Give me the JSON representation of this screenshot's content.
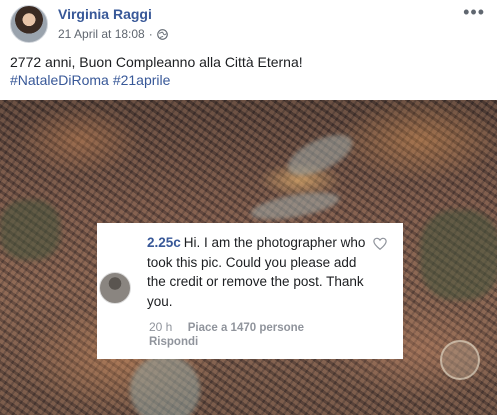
{
  "post": {
    "author": "Virginia Raggi",
    "timestamp": "21 April at 18:08",
    "separator": "·",
    "privacy_icon": "globe-icon",
    "more_icon": "more-options-icon",
    "more_label": "•••",
    "text": "2772 anni, Buon Compleanno alla Città Eterna!",
    "hashtags": [
      "#NataleDiRoma",
      "#21aprile"
    ]
  },
  "comment": {
    "username": "2.25c",
    "text": "Hi. I am the photographer who took this pic. Could you please add the credit or remove the post. Thank you.",
    "time": "20 h",
    "likes": "Piace a 1470 persone",
    "reply": "Rispondi",
    "like_icon": "heart-icon"
  },
  "colors": {
    "link": "#385898",
    "meta": "#606770",
    "muted": "#90949c"
  }
}
